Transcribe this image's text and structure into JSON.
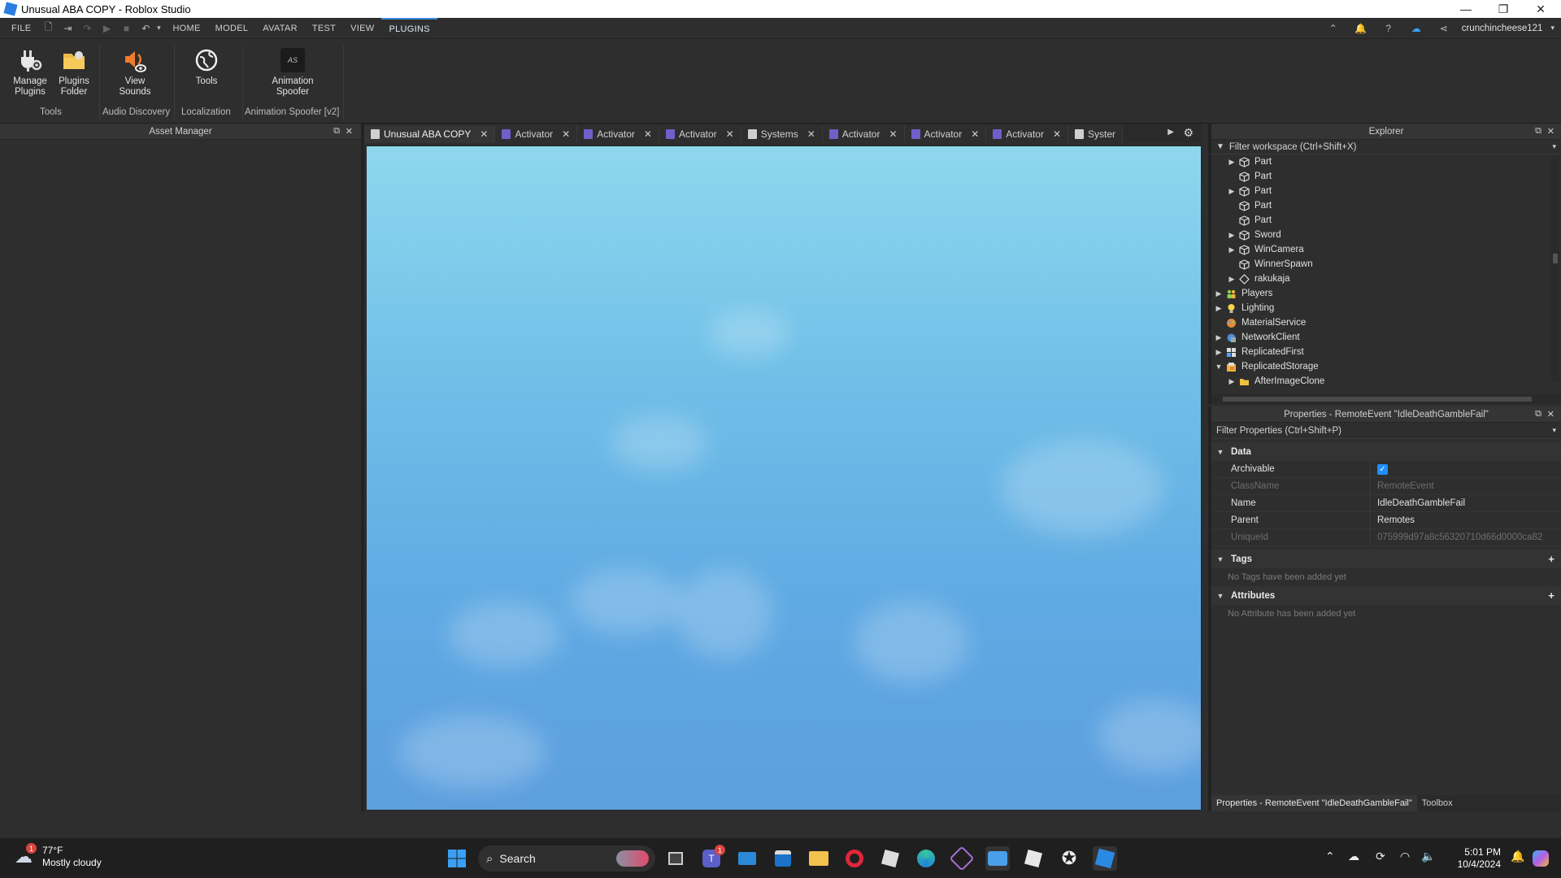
{
  "window": {
    "title": "Unusual ABA COPY - Roblox Studio",
    "controls": {
      "minimize": "—",
      "maximize": "❐",
      "close": "✕"
    }
  },
  "menubar": {
    "file": "FILE",
    "tabs": [
      "HOME",
      "MODEL",
      "AVATAR",
      "TEST",
      "VIEW",
      "PLUGINS"
    ],
    "active_tab": "PLUGINS",
    "username": "crunchincheese121"
  },
  "ribbon": {
    "buttons": [
      {
        "label_line1": "Manage",
        "label_line2": "Plugins",
        "icon": "plug-gear-icon"
      },
      {
        "label_line1": "Plugins",
        "label_line2": "Folder",
        "icon": "folder-icon"
      },
      {
        "label_line1": "View",
        "label_line2": "Sounds",
        "icon": "speaker-eye-icon"
      },
      {
        "label_line1": "Tools",
        "label_line2": "",
        "icon": "globe-icon"
      },
      {
        "label_line1": "Animation",
        "label_line2": "Spoofer",
        "icon": "as-logo-icon"
      }
    ],
    "groups": [
      "Tools",
      "Audio Discovery",
      "Localization",
      "Animation Spoofer [v2]"
    ],
    "as_logo_text": "AS"
  },
  "asset_manager": {
    "title": "Asset Manager"
  },
  "doc_tabs": [
    {
      "label": "Unusual ABA COPY",
      "kind": "place",
      "active": true
    },
    {
      "label": "Activator",
      "kind": "script"
    },
    {
      "label": "Activator",
      "kind": "script"
    },
    {
      "label": "Activator",
      "kind": "script"
    },
    {
      "label": "Systems",
      "kind": "doc"
    },
    {
      "label": "Activator",
      "kind": "script"
    },
    {
      "label": "Activator",
      "kind": "script"
    },
    {
      "label": "Activator",
      "kind": "script"
    },
    {
      "label": "Syster",
      "kind": "doc"
    }
  ],
  "explorer": {
    "title": "Explorer",
    "filter": "Filter workspace (Ctrl+Shift+X)",
    "items": [
      {
        "label": "Part",
        "expander": "collapsed",
        "indent": 2,
        "icon": "part-icon"
      },
      {
        "label": "Part",
        "expander": "none",
        "indent": 2,
        "icon": "part-icon"
      },
      {
        "label": "Part",
        "expander": "collapsed",
        "indent": 2,
        "icon": "part-icon"
      },
      {
        "label": "Part",
        "expander": "none",
        "indent": 2,
        "icon": "part-icon"
      },
      {
        "label": "Part",
        "expander": "none",
        "indent": 2,
        "icon": "part-icon"
      },
      {
        "label": "Sword",
        "expander": "collapsed",
        "indent": 2,
        "icon": "part-icon"
      },
      {
        "label": "WinCamera",
        "expander": "collapsed",
        "indent": 2,
        "icon": "part-icon"
      },
      {
        "label": "WinnerSpawn",
        "expander": "none",
        "indent": 2,
        "icon": "part-icon"
      },
      {
        "label": "rakukaja",
        "expander": "collapsed",
        "indent": 2,
        "icon": "diamond-icon"
      },
      {
        "label": "Players",
        "expander": "collapsed",
        "indent": 1,
        "icon": "players-icon"
      },
      {
        "label": "Lighting",
        "expander": "collapsed",
        "indent": 1,
        "icon": "lightbulb-icon"
      },
      {
        "label": "MaterialService",
        "expander": "none",
        "indent": 1,
        "icon": "material-icon"
      },
      {
        "label": "NetworkClient",
        "expander": "collapsed",
        "indent": 1,
        "icon": "network-icon"
      },
      {
        "label": "ReplicatedFirst",
        "expander": "collapsed",
        "indent": 1,
        "icon": "replicated-icon"
      },
      {
        "label": "ReplicatedStorage",
        "expander": "expanded",
        "indent": 1,
        "icon": "storage-icon"
      },
      {
        "label": "AfterImageClone",
        "expander": "collapsed",
        "indent": 2,
        "icon": "folder-icon"
      }
    ]
  },
  "properties": {
    "title": "Properties - RemoteEvent \"IdleDeathGambleFail\"",
    "filter": "Filter Properties (Ctrl+Shift+P)",
    "sections": {
      "data": "Data",
      "tags": "Tags",
      "attributes": "Attributes"
    },
    "rows": [
      {
        "key": "Archivable",
        "value": "",
        "checkbox": true,
        "dim": false
      },
      {
        "key": "ClassName",
        "value": "RemoteEvent",
        "dim": true
      },
      {
        "key": "Name",
        "value": "IdleDeathGambleFail",
        "dim": false
      },
      {
        "key": "Parent",
        "value": "Remotes",
        "dim": false
      },
      {
        "key": "UniqueId",
        "value": "075999d97a8c56320710d66d0000ca82",
        "dim": true
      }
    ],
    "tags_note": "No Tags have been added yet",
    "attributes_note": "No Attribute has been added yet"
  },
  "bottom_tabs": [
    "Properties - RemoteEvent \"IdleDeathGambleFail\"",
    "Toolbox"
  ],
  "taskbar": {
    "weather_temp": "77°F",
    "weather_desc": "Mostly cloudy",
    "weather_badge": "1",
    "search_label": "Search",
    "teams_badge": "1",
    "time": "5:01 PM",
    "date": "10/4/2024"
  },
  "colors": {
    "accent": "#3a8dde",
    "viewport_sky": "#6fbfe8",
    "checkbox": "#1e90ff"
  }
}
